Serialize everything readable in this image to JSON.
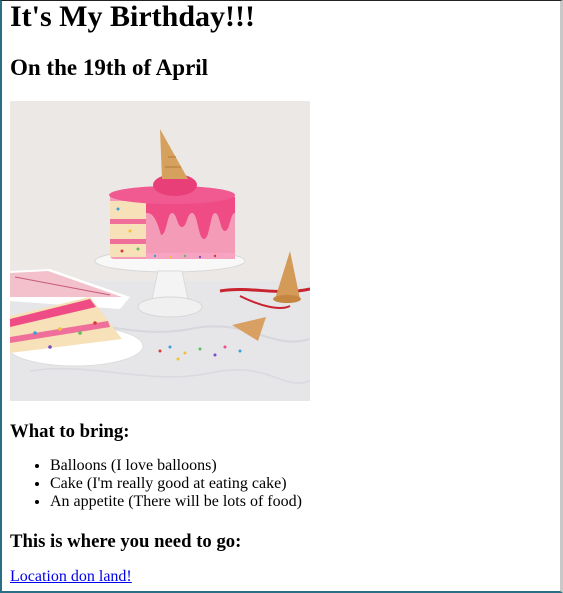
{
  "page": {
    "title": "It's My Birthday!!!",
    "subtitle": "On the 19th of April",
    "bring_heading": "What to bring:",
    "bring_items": [
      "Balloons (I love balloons)",
      "Cake (I'm really good at eating cake)",
      "An appetite (There will be lots of food)"
    ],
    "where_heading": "This is where you need to go:",
    "location_link": "Location don land!"
  },
  "colors": {
    "link": "#0000ee",
    "cake_pink": "#ef6f9a",
    "background": "#ffffff"
  },
  "image": {
    "subject": "pink-drip-birthday-cake"
  }
}
